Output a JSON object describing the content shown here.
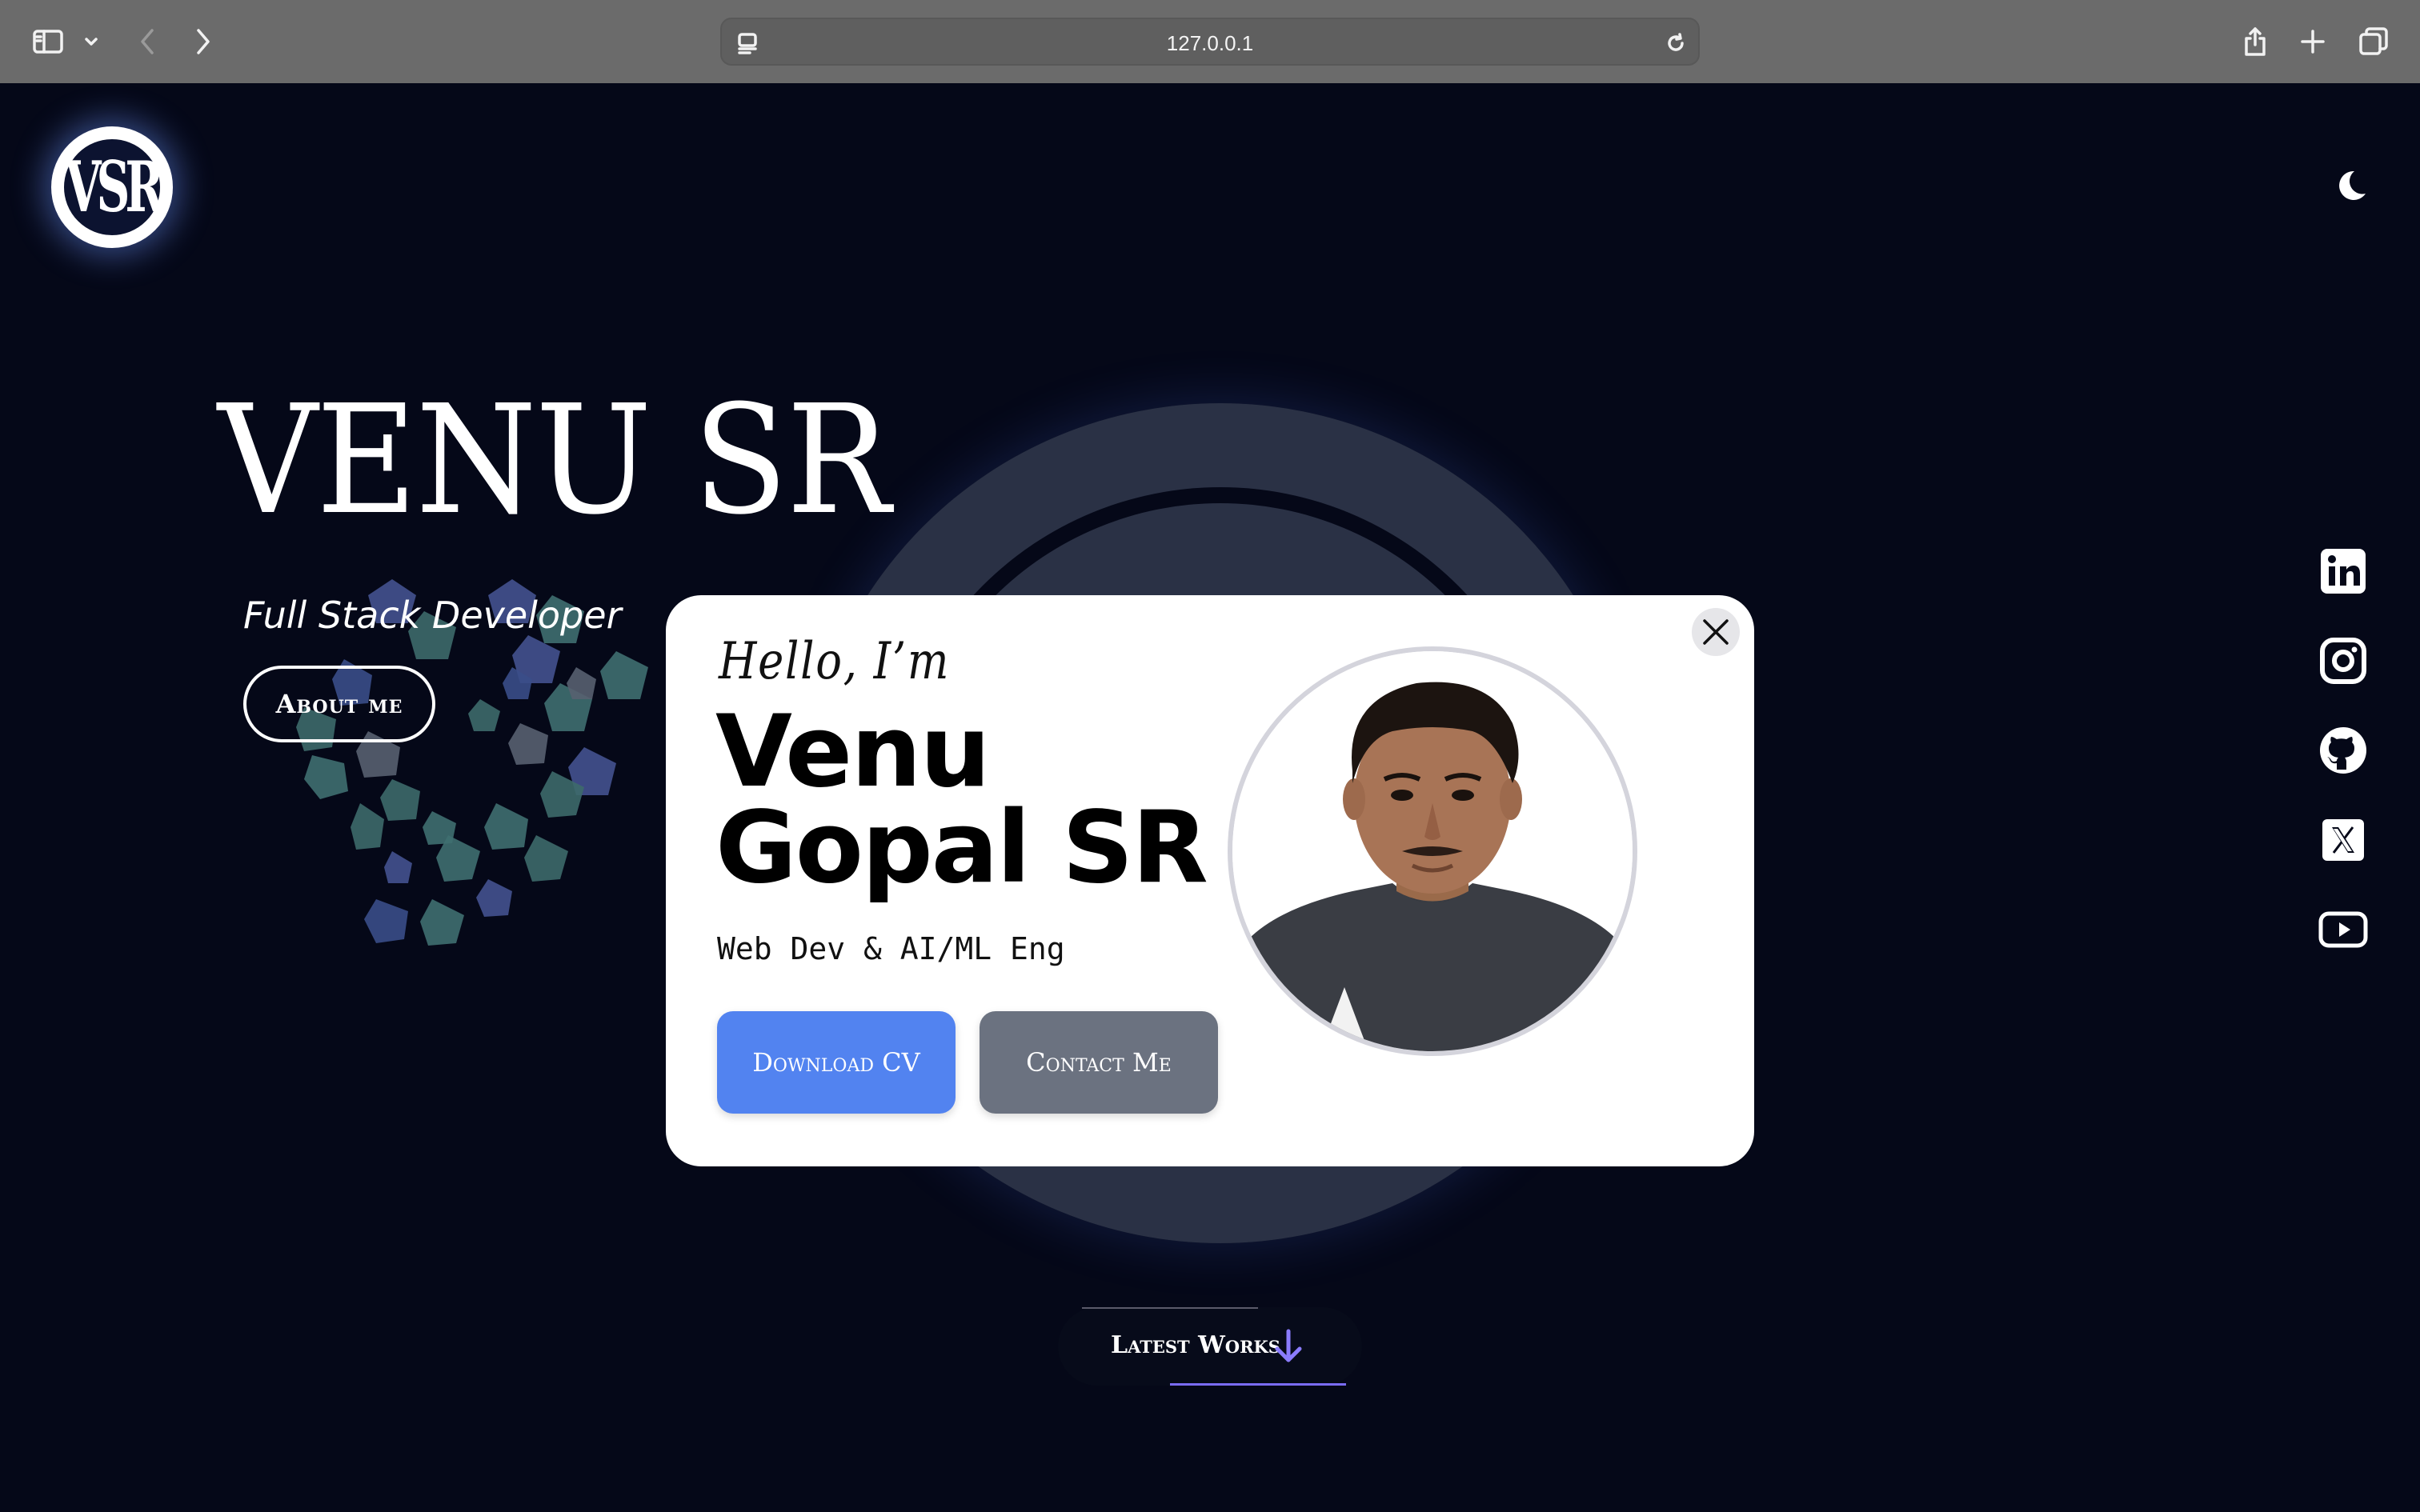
{
  "browser": {
    "url": "127.0.0.1",
    "icons": [
      "sidebar-icon",
      "chevron-down-icon",
      "back-icon",
      "forward-icon",
      "reader-icon",
      "reload-icon",
      "share-icon",
      "plus-icon",
      "tabs-icon"
    ]
  },
  "header": {
    "logo_text": "VSR",
    "theme_icon": "moon-icon"
  },
  "hero": {
    "name": "VENU SR",
    "role": "Full Stack Developer",
    "about_button": "About me"
  },
  "modal": {
    "greeting": "Hello, I’m",
    "name_line1": "Venu",
    "name_line2": "Gopal SR",
    "tagline": "Web Dev & AI/ML Eng",
    "download_button": "Download CV",
    "contact_button": "Contact Me",
    "close_icon": "close-icon"
  },
  "socials": [
    {
      "name": "linkedin-icon",
      "color": "#ffffff"
    },
    {
      "name": "instagram-icon",
      "color": "#ffffff"
    },
    {
      "name": "github-icon",
      "color": "#ffffff"
    },
    {
      "name": "x-icon",
      "color": "#ffffff"
    },
    {
      "name": "youtube-icon",
      "color": "#ffffff"
    }
  ],
  "footer": {
    "latest_works": "Latest Works"
  },
  "colors": {
    "page_bg": "#050818",
    "download_button": "#5283f0",
    "contact_button": "#6b7280",
    "accent": "#7a6cf5"
  }
}
